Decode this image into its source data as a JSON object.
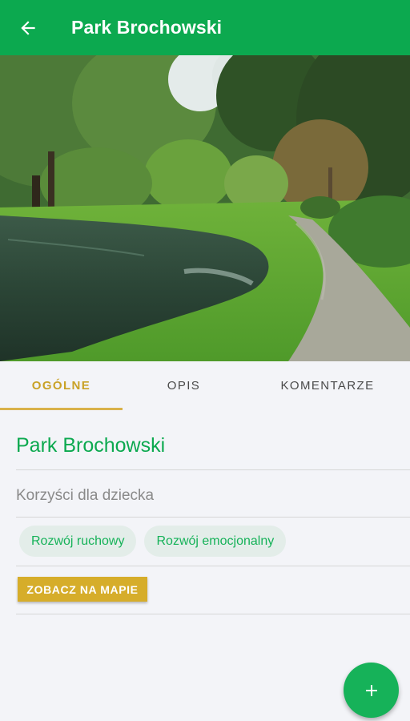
{
  "appbar": {
    "title": "Park Brochowski",
    "back_icon": "arrow-left-icon"
  },
  "hero": {
    "icon": "park-photo"
  },
  "tabs": [
    {
      "label": "OGÓLNE",
      "active": true
    },
    {
      "label": "OPIS",
      "active": false
    },
    {
      "label": "KOMENTARZE",
      "active": false
    }
  ],
  "details": {
    "title": "Park Brochowski",
    "benefits_label": "Korzyści dla dziecka",
    "chips": [
      "Rozwój ruchowy",
      "Rozwój emocjonalny"
    ],
    "map_button": "ZOBACZ NA MAPIE"
  },
  "fab": {
    "icon": "plus-icon",
    "label": "+"
  },
  "colors": {
    "primary": "#0ca94f",
    "accent": "#d6ad2a",
    "chip_bg": "#e3ede9",
    "chip_text": "#16b259"
  }
}
